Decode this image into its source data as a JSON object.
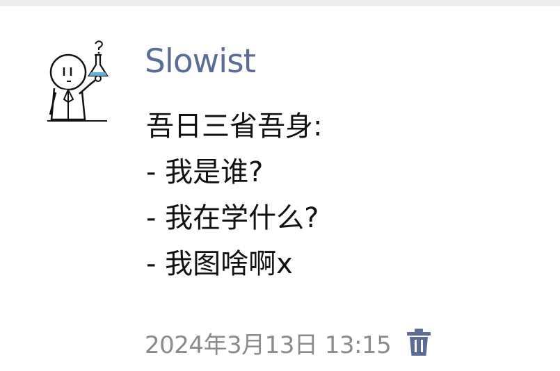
{
  "post": {
    "author": "Slowist",
    "lines": [
      "吾日三省吾身:",
      "- 我是谁?",
      "- 我在学什么?",
      "- 我图啥啊x"
    ],
    "timestamp": "2024年3月13日 13:15"
  },
  "icons": {
    "avatar": "scientist-with-flask-icon",
    "delete": "trash-icon"
  },
  "colors": {
    "author": "#5b6d97",
    "timestamp": "#8a8a8a",
    "trash": "#5b6d97",
    "flask_liquid": "#5fb3d9"
  }
}
